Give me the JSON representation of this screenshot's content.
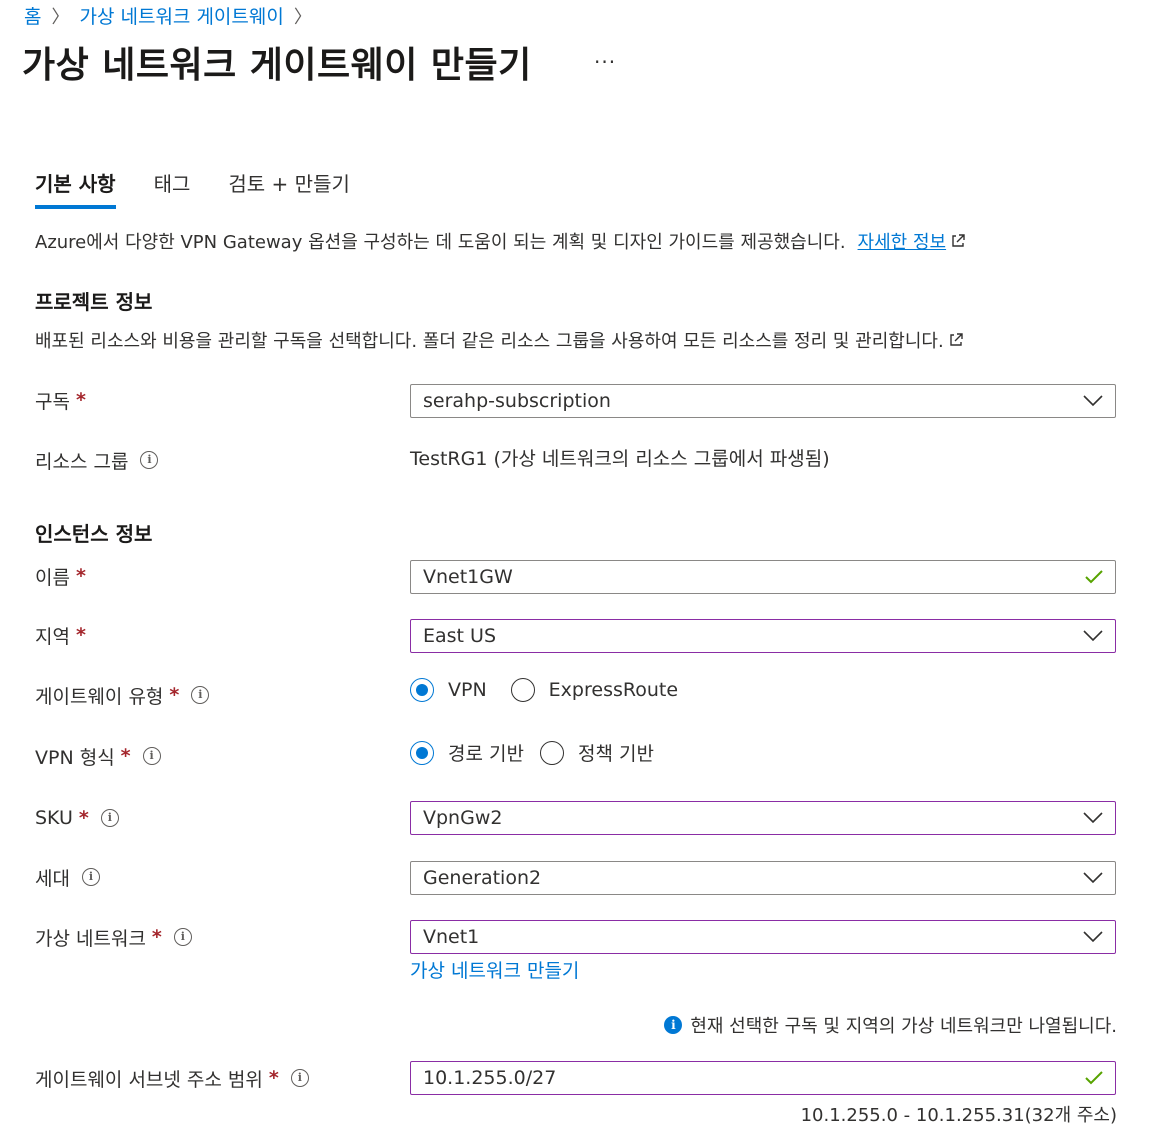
{
  "breadcrumb": {
    "home": "홈",
    "current": "가상 네트워크 게이트웨이"
  },
  "page": {
    "title": "가상 네트워크 게이트웨이 만들기",
    "more": "···"
  },
  "tabs": [
    {
      "label": "기본 사항"
    },
    {
      "label": "태그"
    },
    {
      "label": "검토 + 만들기"
    }
  ],
  "intro": {
    "text": "Azure에서 다양한 VPN Gateway 옵션을 구성하는 데 도움이 되는 계획 및 디자인 가이드를 제공했습니다.",
    "link": "자세한 정보"
  },
  "project": {
    "heading": "프로젝트 정보",
    "desc": "배포된 리소스와 비용을 관리할 구독을 선택합니다. 폴더 같은 리소스 그룹을 사용하여 모든 리소스를 정리 및 관리합니다.",
    "subscription_label": "구독",
    "subscription_value": "serahp-subscription",
    "rg_label": "리소스 그룹",
    "rg_value": "TestRG1 (가상 네트워크의 리소스 그룹에서 파생됨)"
  },
  "instance": {
    "heading": "인스턴스 정보",
    "name_label": "이름",
    "name_value": "Vnet1GW",
    "region_label": "지역",
    "region_value": "East US",
    "gwtype_label": "게이트웨이 유형",
    "gwtype_options": [
      "VPN",
      "ExpressRoute"
    ],
    "vpntype_label": "VPN 형식",
    "vpntype_options": [
      "경로 기반",
      "정책 기반"
    ],
    "sku_label": "SKU",
    "sku_value": "VpnGw2",
    "gen_label": "세대",
    "gen_value": "Generation2",
    "vnet_label": "가상 네트워크",
    "vnet_value": "Vnet1",
    "vnet_create_link": "가상 네트워크 만들기",
    "vnet_notice": "현재 선택한 구독 및 지역의 가상 네트워크만 나열됩니다.",
    "subnet_label": "게이트웨이 서브넷 주소 범위",
    "subnet_value": "10.1.255.0/27",
    "subnet_hint": "10.1.255.0 - 10.1.255.31(32개 주소)"
  },
  "required_marker": "*",
  "colors": {
    "accent": "#0078d4",
    "required": "#a4262c",
    "valid": "#57a300",
    "focus_border": "#8a2da5"
  }
}
